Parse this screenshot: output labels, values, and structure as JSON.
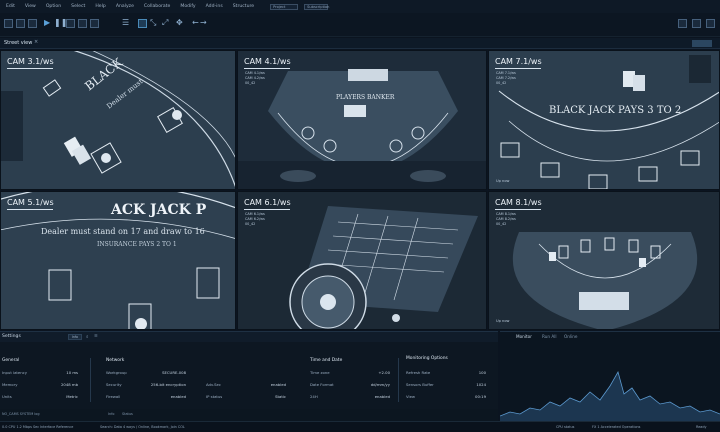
{
  "menu": {
    "items": [
      "Edit",
      "View",
      "Option",
      "Select",
      "Help",
      "Analyze",
      "Collaborate",
      "Modify",
      "Add-ins",
      "Structure"
    ],
    "field1": "Project",
    "field2": "Subscription"
  },
  "view": {
    "title": "Street view",
    "close": "×",
    "right_button": ""
  },
  "cameras": [
    {
      "id": "cam1",
      "label": "CAM 3.1/ws",
      "meta": [],
      "live": "Up now"
    },
    {
      "id": "cam2",
      "label": "CAM 4.1/ws",
      "meta": [
        "CAM 4.1/ws",
        "CAM 4.2/ws",
        "00_42"
      ],
      "live": "Up now"
    },
    {
      "id": "cam3",
      "label": "CAM 7.1/ws",
      "meta": [
        "CAM 7.1/ws",
        "CAM 7.2/ws",
        "00_42"
      ],
      "live": "Up now"
    },
    {
      "id": "cam4",
      "label": "CAM 5.1/ws",
      "meta": [],
      "live": "Up now"
    },
    {
      "id": "cam5",
      "label": "CAM 6.1/ws",
      "meta": [
        "CAM 6.1/ws",
        "CAM 6.2/ws",
        "00_42"
      ],
      "live": "Up now"
    },
    {
      "id": "cam6",
      "label": "CAM 8.1/ws",
      "meta": [
        "CAM 8.1/ws",
        "CAM 8.2/ws",
        "00_42"
      ],
      "live": "Up now"
    }
  ],
  "table_text": {
    "blackjack_pays": "BLACK JACK PAYS 3 TO 2",
    "dealer_rule": "Dealer must stand on 17 and draw to 16",
    "insurance": "INSURANCE PAYS 2 TO 1",
    "players_banker": "PLAYERS  BANKER"
  },
  "settings": {
    "title": "Settings",
    "tag": "Info",
    "general": {
      "heading": "General",
      "rows": [
        {
          "key": "Input latency",
          "value": "10 ms"
        },
        {
          "key": "Memory",
          "value": "2048 mb"
        },
        {
          "key": "Units",
          "value": "Metric"
        }
      ]
    },
    "network": {
      "heading": "Network",
      "rows": [
        {
          "key": "Workgroup",
          "value": "SECURE-008",
          "extra_key": "",
          "extra_value": ""
        },
        {
          "key": "Security",
          "value": "256-bit encryption",
          "extra_key": "Adv.Sec",
          "extra_value": "enabled"
        },
        {
          "key": "Firewall",
          "value": "enabled",
          "extra_key": "IP status",
          "extra_value": "Static"
        }
      ]
    },
    "time": {
      "heading": "Time and Date",
      "rows": [
        {
          "key": "Time zone",
          "value": "+2.00"
        },
        {
          "key": "Date Format",
          "value": "dd/mm/yy"
        },
        {
          "key": "24H",
          "value": "enabled"
        }
      ]
    },
    "monitoring": {
      "heading": "Monitoring Options",
      "rows": [
        {
          "key": "Refresh Rate",
          "value": "100"
        },
        {
          "key": "Sensors Buffer",
          "value": "1024"
        },
        {
          "key": "View",
          "value": "00:19"
        }
      ]
    }
  },
  "monitor": {
    "tabs": [
      "Monitor",
      "Run All",
      "Online"
    ]
  },
  "midstrip": {
    "items": [
      "NO_CAMS SYSTEM log",
      "Info",
      "Status"
    ]
  },
  "status": {
    "items": [
      "0.0  CPU 1.2  Mbps Sec",
      "Interface Reference",
      "Search: Data 4 ways / Online, Bookmark, Join COL",
      "CPU status",
      "FX 1 Accelerated Operations",
      "Ready"
    ]
  },
  "colors": {
    "felt": "#2b3d4d",
    "accent": "#4a8ab8",
    "panel": "#0d1722",
    "text": "#c7d4e0"
  }
}
